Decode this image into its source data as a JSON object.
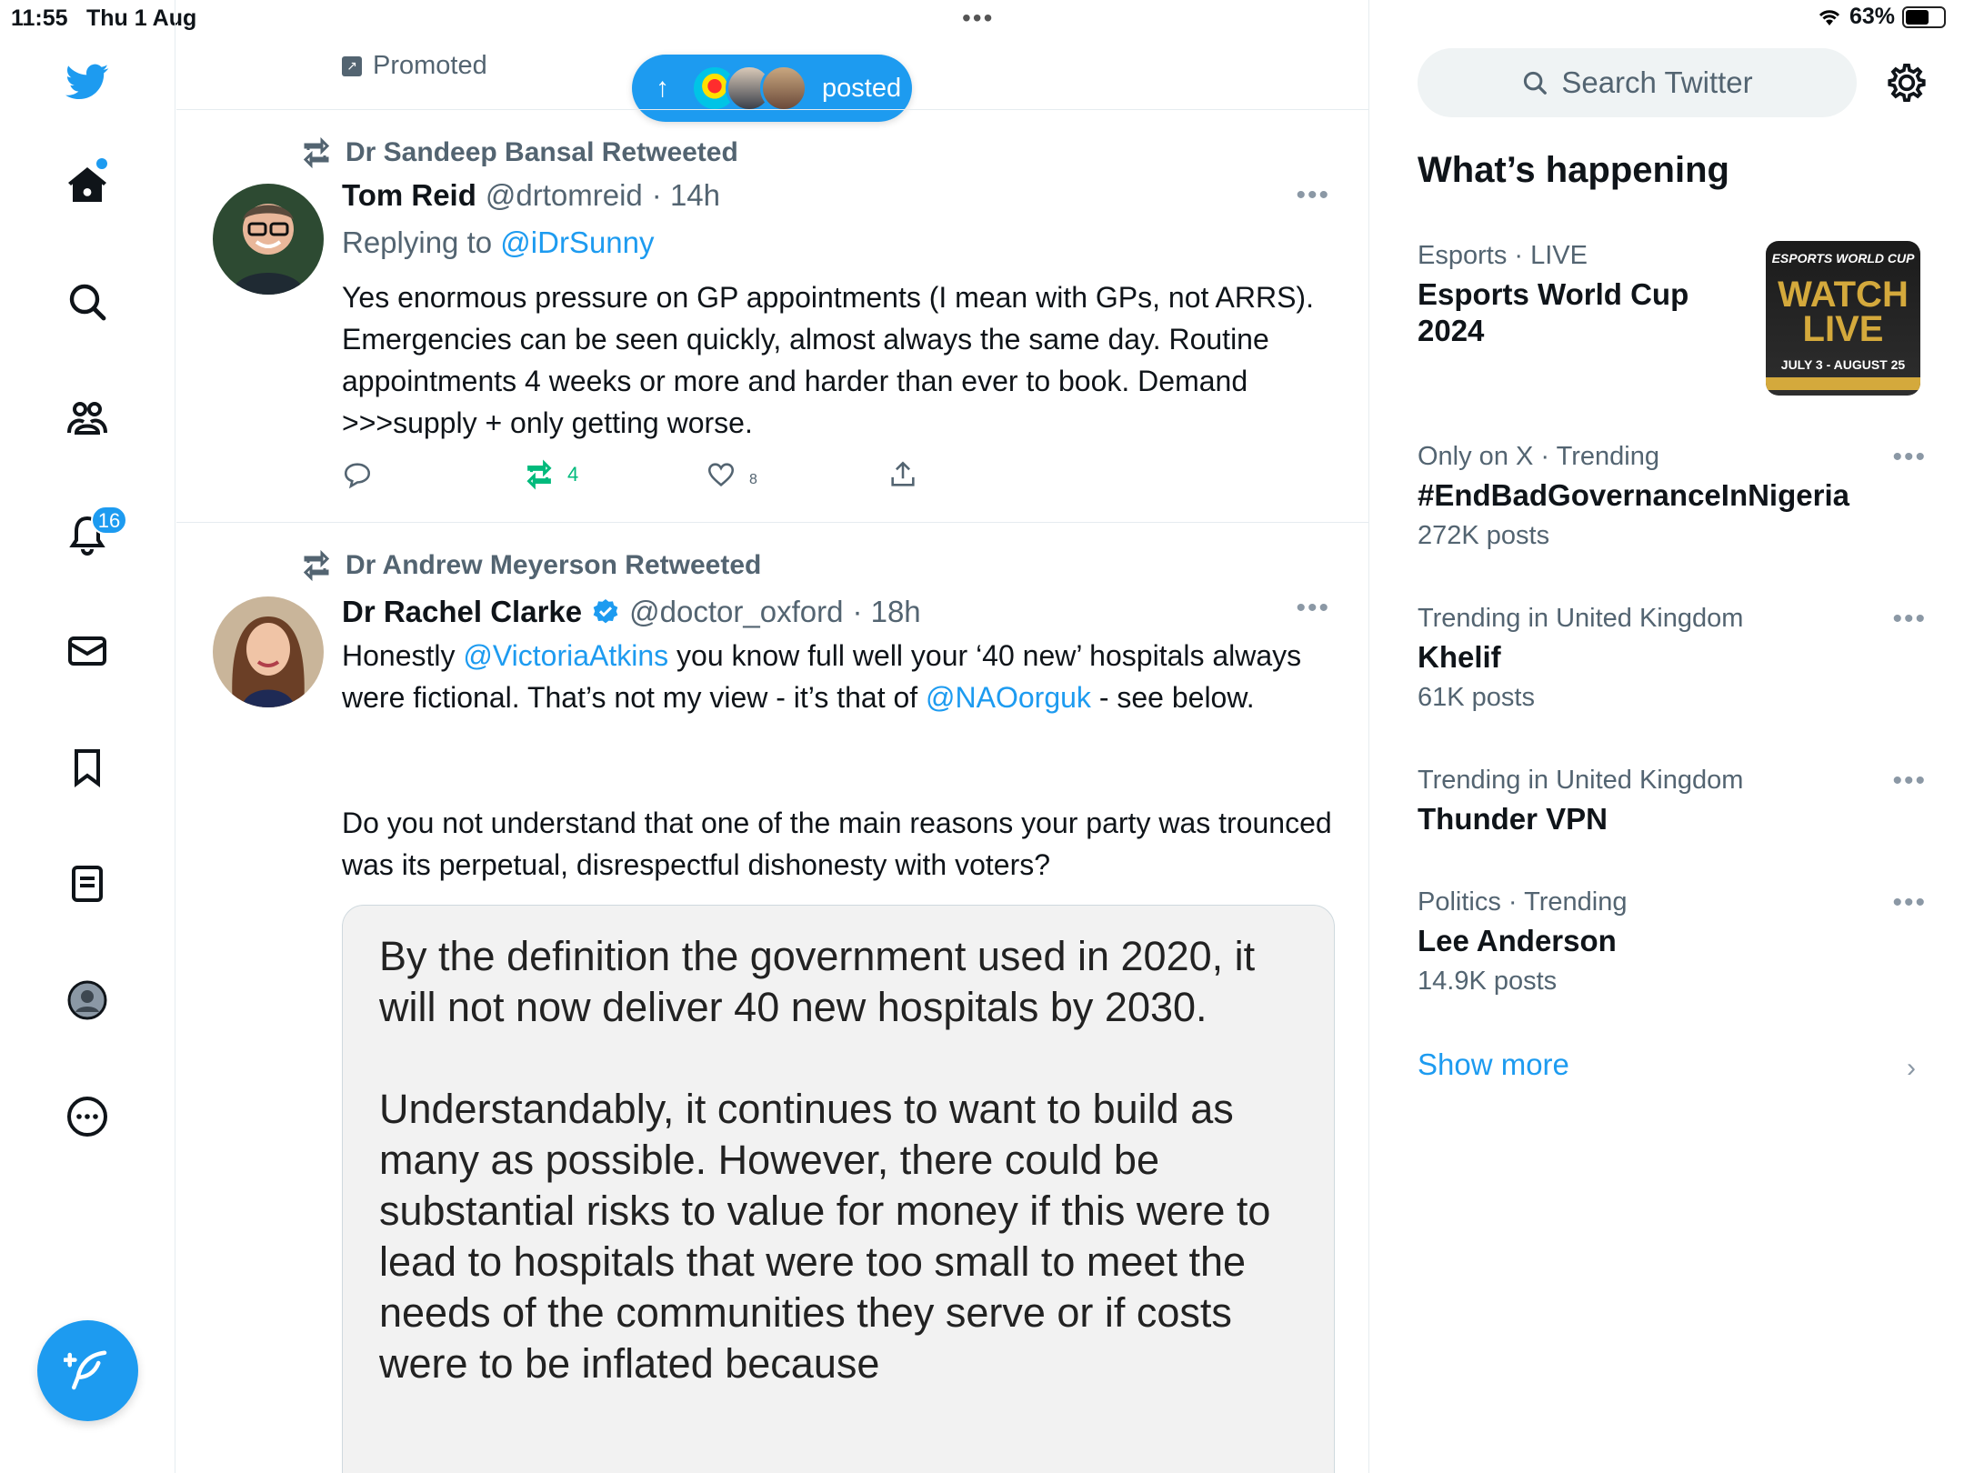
{
  "status_bar": {
    "time": "11:55",
    "date": "Thu 1 Aug",
    "battery": "63%",
    "battery_level": 0.63
  },
  "nav": {
    "notifications_badge": "16"
  },
  "feed": {
    "promoted_label": "Promoted",
    "posted_pill_label": "posted",
    "tweets": [
      {
        "retweeted_by": "Dr Sandeep Bansal Retweeted",
        "name": "Tom Reid",
        "handle": "@drtomreid",
        "time": "· 14h",
        "replying_prefix": "Replying to",
        "replying_to": "@iDrSunny",
        "body": "Yes enormous pressure on GP appointments (I mean with GPs, not ARRS). Emergencies can be seen quickly, almost always the same day. Routine appointments 4 weeks or more and harder than ever to book. Demand >>>supply + only getting worse.",
        "retweet_count": "4",
        "like_count": "8"
      },
      {
        "retweeted_by": "Dr Andrew Meyerson Retweeted",
        "name": "Dr Rachel Clarke",
        "handle": "@doctor_oxford",
        "time": "· 18h",
        "body_p1_a": "Honestly ",
        "mention1": "@VictoriaAtkins",
        "body_p1_b": " you know full well your ‘40 new’ hospitals always were fictional. That’s not my view - it’s that of ",
        "mention2": "@NAOorguk",
        "body_p1_c": " - see below.",
        "body_p2": "Do you not understand that one of the main reasons your party was trounced was its perpetual, disrespectful dishonesty with voters?",
        "quote_p1": "By the definition the government used in 2020, it will not now deliver 40 new hospitals by 2030.",
        "quote_p2": "Understandably, it continues to want to build as many as possible. However, there could be substantial risks to value for money if this were to lead to hospitals that were too small to meet the needs of the communities they serve or if costs were to be inflated because"
      }
    ]
  },
  "sidebar": {
    "search_placeholder": "Search Twitter",
    "heading": "What’s happening",
    "trends": [
      {
        "meta": "Esports · LIVE",
        "title": "Esports World Cup 2024",
        "count": ""
      },
      {
        "meta": "Only on X · Trending",
        "title": "#EndBadGovernanceInNigeria",
        "count": "272K posts"
      },
      {
        "meta": "Trending in United Kingdom",
        "title": "Khelif",
        "count": "61K posts"
      },
      {
        "meta": "Trending in United Kingdom",
        "title": "Thunder VPN",
        "count": ""
      },
      {
        "meta": "Politics · Trending",
        "title": "Lee Anderson",
        "count": "14.9K posts"
      }
    ],
    "esports_image": {
      "top": "ESPORTS WORLD CUP",
      "main": "WATCH LIVE",
      "dates": "JULY 3 - AUGUST 25"
    },
    "show_more": "Show more"
  },
  "colors": {
    "accent": "#1d9bf0",
    "retweet_green": "#00ba7c",
    "secondary_text": "#536471"
  }
}
